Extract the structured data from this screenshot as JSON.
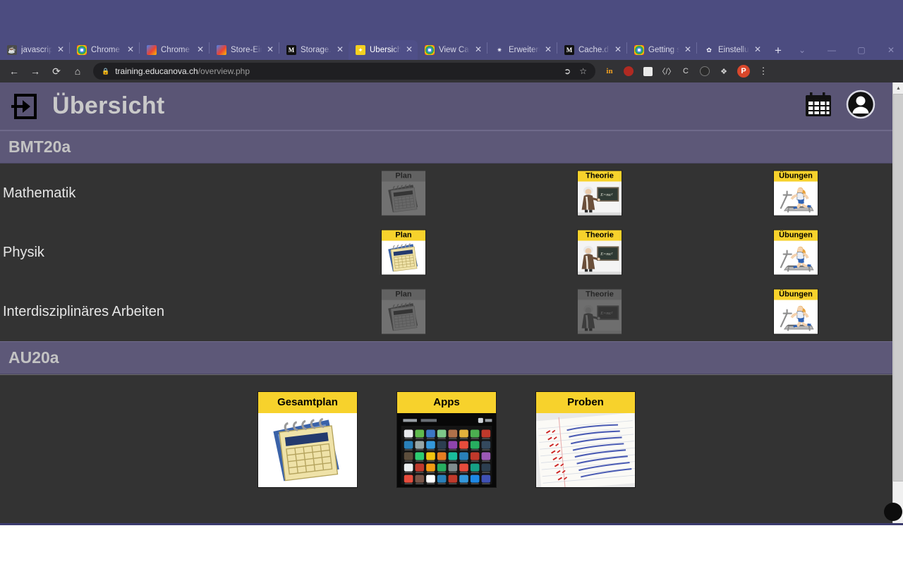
{
  "browser": {
    "tabs": [
      {
        "title": "javascript - c",
        "favicon": "java-icon",
        "active": false
      },
      {
        "title": "Chrome We",
        "favicon": "chrome-icon",
        "active": false
      },
      {
        "title": "Chrome We",
        "favicon": "chrome-store-icon",
        "active": false
      },
      {
        "title": "Store-Eintra",
        "favicon": "chrome-store-icon",
        "active": false
      },
      {
        "title": "Storage.get",
        "favicon": "mdn-icon",
        "active": false
      },
      {
        "title": "Übersicht",
        "favicon": "educanova-icon",
        "active": true
      },
      {
        "title": "View Cache",
        "favicon": "chrome-icon",
        "active": false
      },
      {
        "title": "Erweiterung",
        "favicon": "puzzle-icon",
        "active": false
      },
      {
        "title": "Cache.delet",
        "favicon": "mdn-icon",
        "active": false
      },
      {
        "title": "Getting star",
        "favicon": "chrome-icon",
        "active": false
      },
      {
        "title": "Einstellunge",
        "favicon": "gear-icon",
        "active": false
      }
    ],
    "new_tab_label": "+",
    "close_label": "✕",
    "window_controls": [
      "⌄",
      "—",
      "▢",
      "✕"
    ],
    "nav": {
      "back": "←",
      "forward": "→",
      "reload": "⟳",
      "home": "⌂"
    },
    "omnibox": {
      "lock_icon": "lock-icon",
      "url_domain": "training.educanova.ch",
      "url_path": "/overview.php",
      "share_icon": "share-icon",
      "bookmark_icon": "star-icon"
    },
    "extensions": [
      {
        "name": "linkedin-extension-icon",
        "label": "in"
      },
      {
        "name": "red-extension-icon",
        "label": ""
      },
      {
        "name": "package-extension-icon",
        "label": ""
      },
      {
        "name": "code-extension-icon",
        "label": "‹/›"
      },
      {
        "name": "colorzilla-extension-icon",
        "label": "C"
      },
      {
        "name": "dark-extension-icon",
        "label": ""
      },
      {
        "name": "puzzle-extensions-icon",
        "label": "🧩"
      }
    ],
    "profile_initial": "P",
    "menu_icon": "⋮"
  },
  "app": {
    "logo_icon": "login-box-arrow-icon",
    "title": "Übersicht",
    "calendar_icon": "calendar-icon",
    "account_icon": "account-avatar-icon"
  },
  "groups": [
    {
      "name": "BMT20a",
      "subjects": [
        {
          "name": "Mathematik",
          "cards": [
            {
              "label": "Plan",
              "art": "calendar-art",
              "enabled": false
            },
            {
              "label": "Theorie",
              "art": "einstein-blackboard-art",
              "enabled": true
            },
            {
              "label": "Übungen",
              "art": "treadmill-runner-art",
              "enabled": true
            }
          ]
        },
        {
          "name": "Physik",
          "cards": [
            {
              "label": "Plan",
              "art": "calendar-art",
              "enabled": true
            },
            {
              "label": "Theorie",
              "art": "einstein-blackboard-art",
              "enabled": true
            },
            {
              "label": "Übungen",
              "art": "treadmill-runner-art",
              "enabled": true
            }
          ]
        },
        {
          "name": "Interdisziplinäres Arbeiten",
          "cards": [
            {
              "label": "Plan",
              "art": "calendar-art",
              "enabled": false
            },
            {
              "label": "Theorie",
              "art": "einstein-blackboard-art",
              "enabled": false
            },
            {
              "label": "Übungen",
              "art": "treadmill-runner-art",
              "enabled": true
            }
          ]
        }
      ]
    },
    {
      "name": "AU20a",
      "subjects": []
    }
  ],
  "bottom_cards": [
    {
      "label": "Gesamtplan",
      "art": "calendar-art"
    },
    {
      "label": "Apps",
      "art": "app-grid-art"
    },
    {
      "label": "Proben",
      "art": "handwritten-notes-art"
    }
  ],
  "colors": {
    "accent_yellow": "#f7d22c",
    "header_purple": "#5a5575",
    "group_purple": "#5d5878",
    "page_background": "#333333",
    "browser_purple": "#4c4c80"
  }
}
